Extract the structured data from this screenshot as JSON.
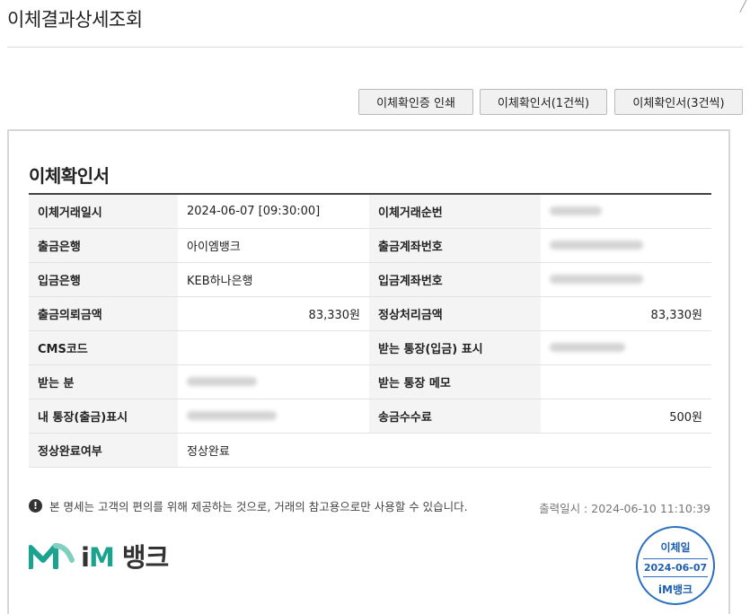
{
  "page": {
    "title": "이체결과상세조회",
    "corner_mark": "╱"
  },
  "buttons": {
    "print_cert": "이체확인증 인쇄",
    "confirm_1": "이체확인서(1건씩)",
    "confirm_3": "이체확인서(3건씩)"
  },
  "document": {
    "title": "이체확인서",
    "rows": [
      {
        "l1": "이체거래일시",
        "v1": "2024-06-07 [09:30:00]",
        "l2": "이체거래순번",
        "v2": ""
      },
      {
        "l1": "출금은행",
        "v1": "아이엠뱅크",
        "l2": "출금계좌번호",
        "v2": ""
      },
      {
        "l1": "입금은행",
        "v1": "KEB하나은행",
        "l2": "입금계좌번호",
        "v2": ""
      },
      {
        "l1": "출금의뢰금액",
        "v1": "83,330원",
        "l2": "정상처리금액",
        "v2": "83,330원"
      },
      {
        "l1": "CMS코드",
        "v1": "",
        "l2": "받는 통장(입금) 표시",
        "v2": ""
      },
      {
        "l1": "받는 분",
        "v1": "",
        "l2": "받는 통장 메모",
        "v2": ""
      },
      {
        "l1": "내 통장(출금)표시",
        "v1": "",
        "l2": "송금수수료",
        "v2": "500원"
      },
      {
        "l1": "정상완료여부",
        "v1": "정상완료"
      }
    ],
    "notice": "본 명세는 고객의 편의를 위해 제공하는 것으로, 거래의 참고용으로만 사용할 수 있습니다.",
    "printed_at": "출력일시 : 2024-06-10 11:10:39"
  },
  "logo": {
    "brand_i": "i",
    "brand_m": "M",
    "brand_rest": " 뱅크",
    "accent_color": "#1aa38f"
  },
  "stamp": {
    "label": "이체일",
    "date": "2024-06-07",
    "brand": "iM뱅크",
    "color": "#2b6fc0"
  }
}
